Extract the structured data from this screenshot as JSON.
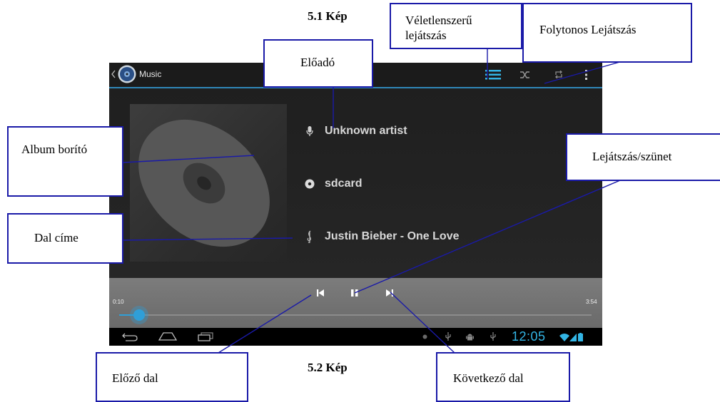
{
  "captions": {
    "top": "5.1 Kép",
    "bottom": "5.2 Kép"
  },
  "callouts": {
    "shuffle": "Véletlenszerű lejátszás",
    "repeat": "Folytonos Lejátszás",
    "artist": "Előadó",
    "album_cover": "Album borító",
    "play_pause": "Lejátszás/szünet",
    "song_title": "Dal címe",
    "previous": "Előző dal",
    "next": "Következő dal"
  },
  "device": {
    "app_title": "Music",
    "artist": "Unknown artist",
    "album": "sdcard",
    "song": "Justin Bieber - One Love",
    "elapsed": "0:10",
    "duration": "3:54",
    "progress": 0.043,
    "clock": "12:05",
    "accent": "#33b5e5"
  },
  "icons": {
    "back": "back-chevron-icon",
    "app": "music-app-icon",
    "now_playing": "now-playing-list-icon",
    "shuffle": "shuffle-icon",
    "repeat": "repeat-icon",
    "overflow": "overflow-menu-icon",
    "mic": "microphone-icon",
    "disc": "disc-icon",
    "clef": "treble-clef-icon",
    "prev": "previous-track-icon",
    "pause": "pause-icon",
    "next": "next-track-icon"
  }
}
